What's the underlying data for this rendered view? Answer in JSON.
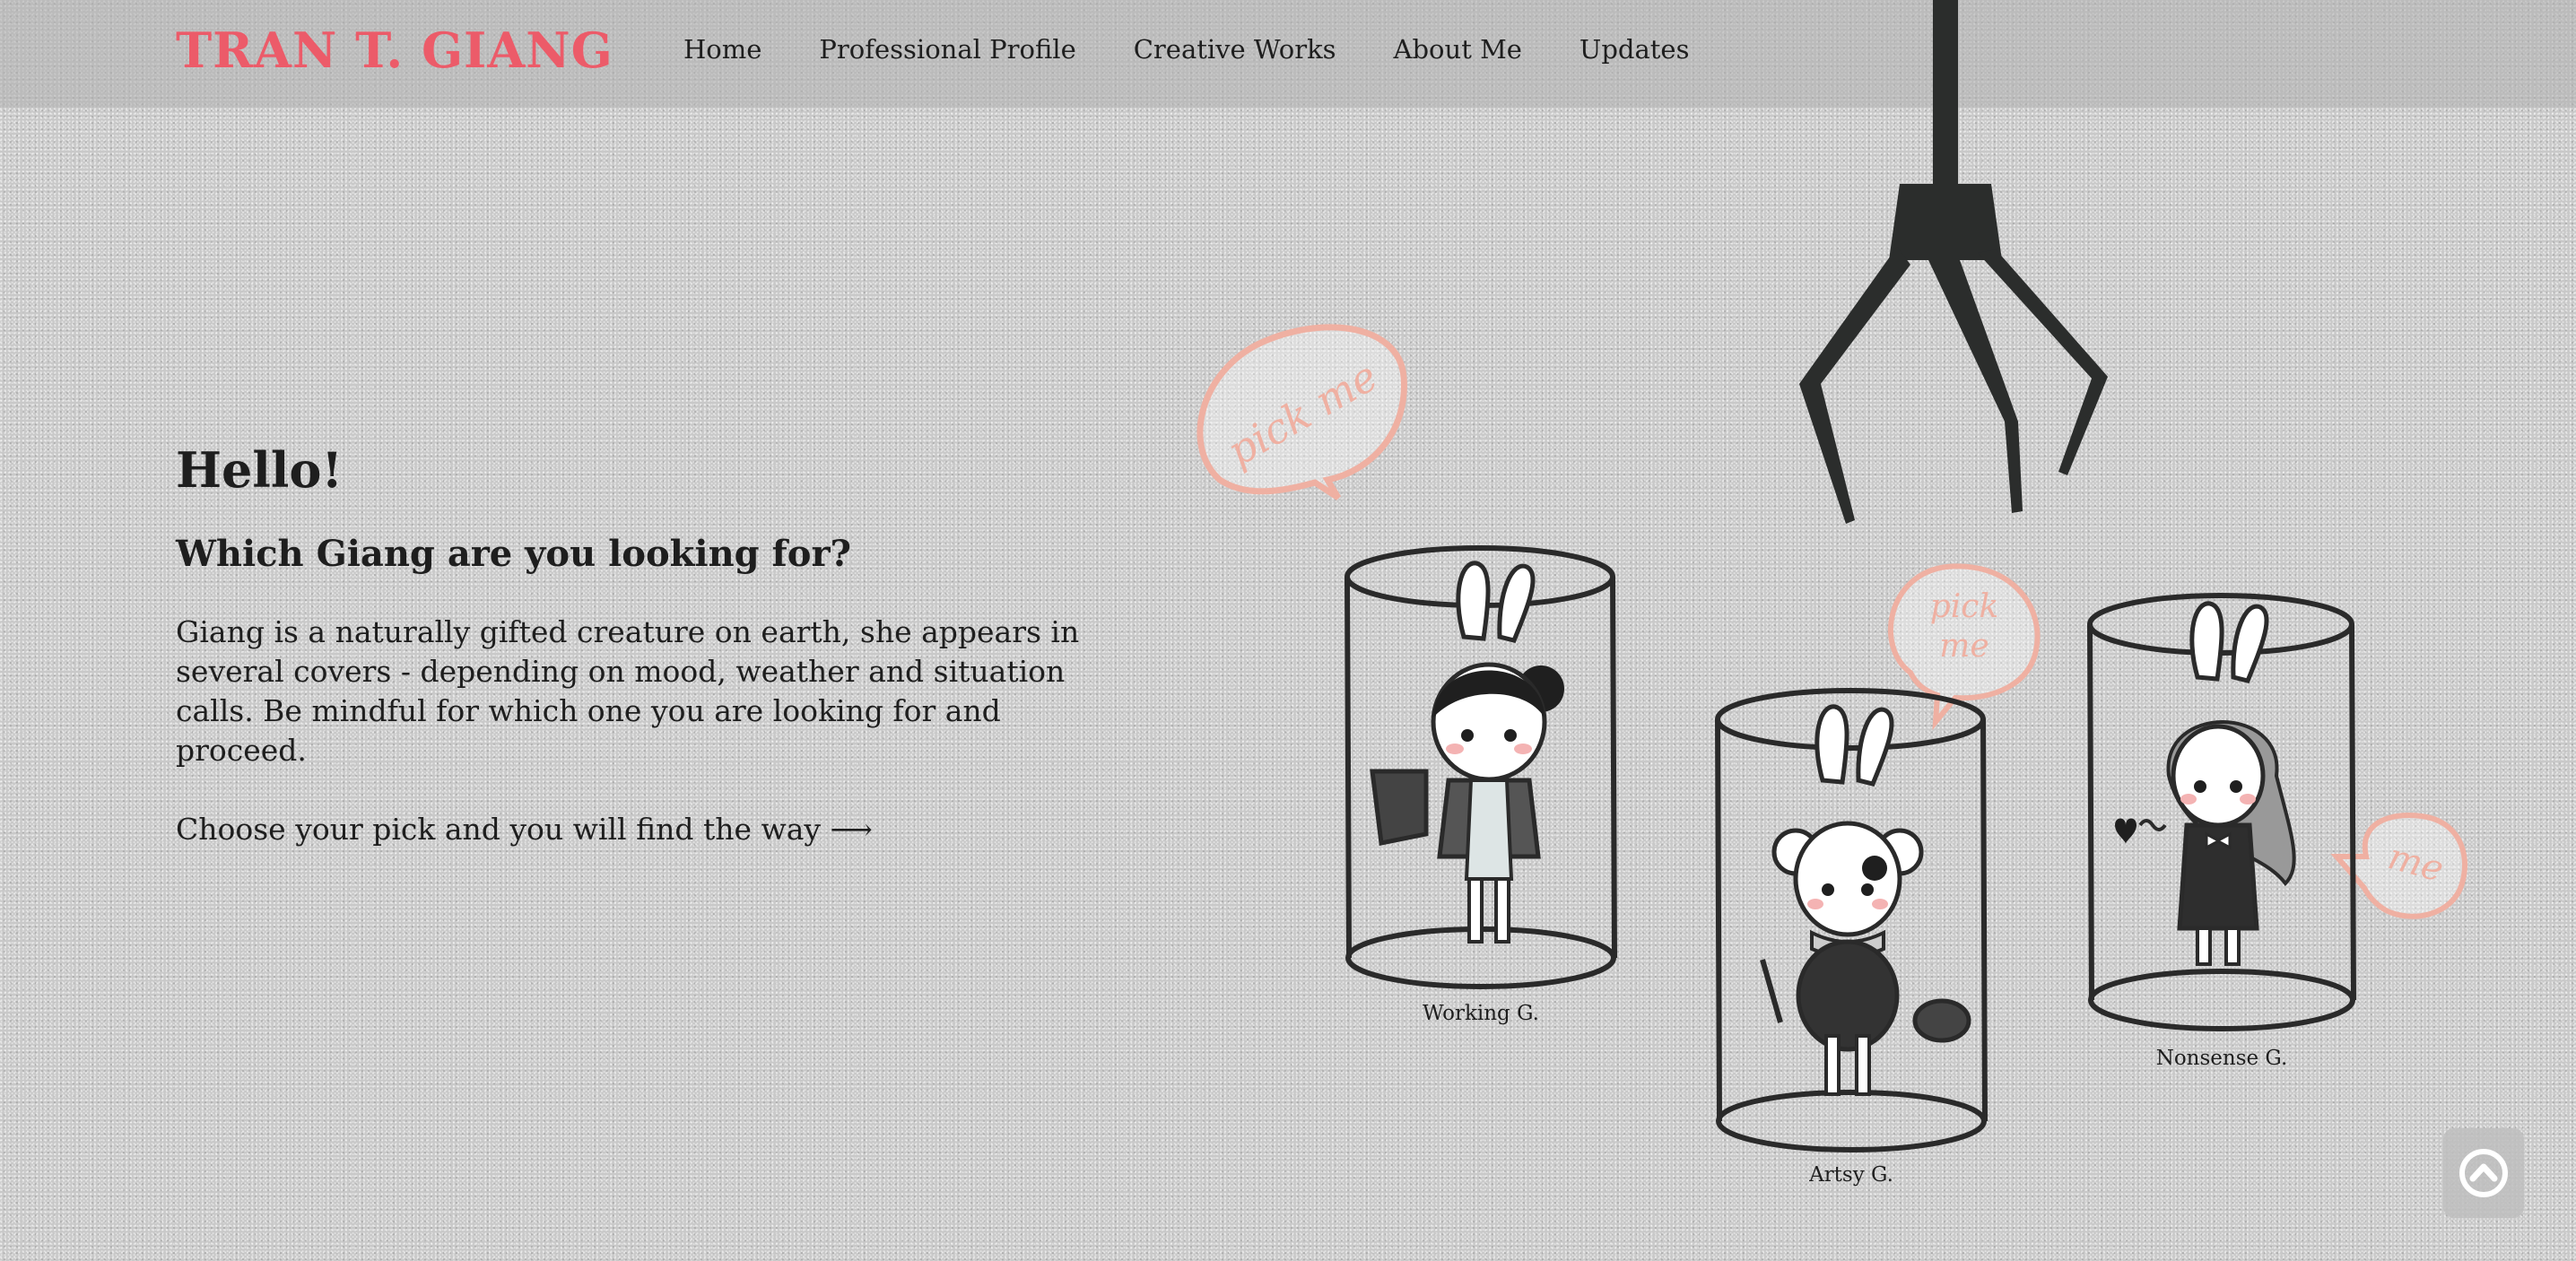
{
  "site": {
    "logo": "TRAN T. GIANG",
    "brand_color": "#ec5b69"
  },
  "nav": {
    "items": [
      {
        "label": "Home"
      },
      {
        "label": "Professional Profile"
      },
      {
        "label": "Creative Works"
      },
      {
        "label": "About Me"
      },
      {
        "label": "Updates"
      }
    ]
  },
  "hero": {
    "greeting": "Hello!",
    "question": "Which Giang are you looking for?",
    "intro": "Giang is a naturally gifted creature on earth, she appears in several covers - depending on mood, weather and situation calls. Be mindful for which one you are looking for and proceed.",
    "cta": "Choose your pick and you will find the way ⟶"
  },
  "characters": [
    {
      "label": "Working G."
    },
    {
      "label": "Artsy G."
    },
    {
      "label": "Nonsense G."
    }
  ],
  "bubbles": {
    "pick_me": "pick me",
    "pick": "pick",
    "me": "me"
  },
  "back_to_top": {
    "icon": "chevron-up-icon"
  },
  "colors": {
    "bubble": "#efb0a2",
    "ink": "#2a2a2a",
    "claw": "#2b2d2c"
  }
}
